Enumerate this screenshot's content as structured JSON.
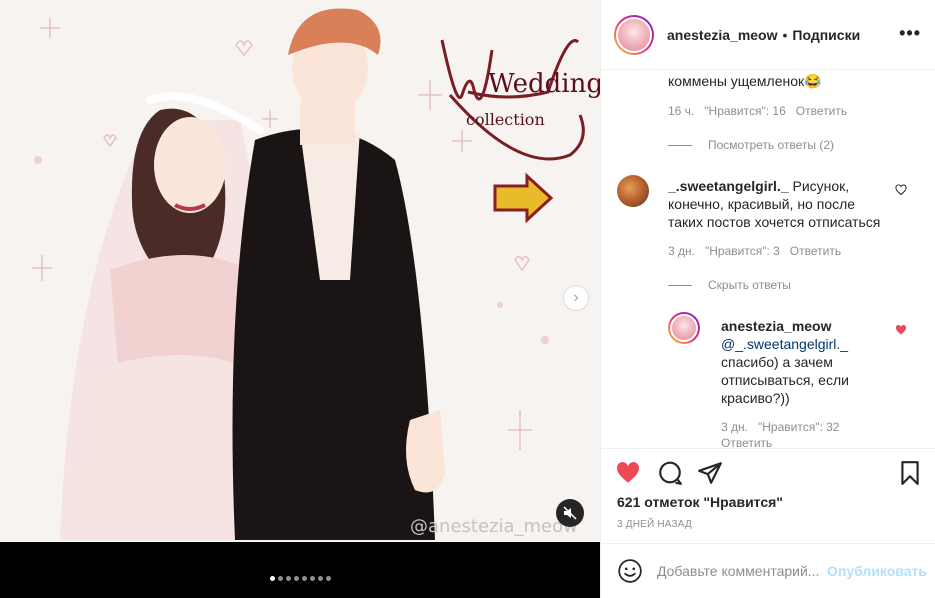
{
  "media": {
    "watermark": "@anestezia_meow",
    "title_main": "Wedding",
    "title_sub": "collection",
    "carousel_dots": 8,
    "active_dot": 0
  },
  "header": {
    "username": "anestezia_meow",
    "separator": "•",
    "follow_label": "Подписки",
    "more_label": "•••"
  },
  "comments": {
    "first_fragment": "коммены ущемленок😂",
    "first_meta": {
      "time": "16 ч.",
      "likes": "\"Нравится\": 16",
      "reply": "Ответить"
    },
    "view_replies": "Посмотреть ответы (2)",
    "second": {
      "username": "_.sweetangelgirl._",
      "text": "Рисунок, конечно, красивый, но после таких постов хочется отписаться",
      "meta": {
        "time": "3 дн.",
        "likes": "\"Нравится\": 3",
        "reply": "Ответить"
      }
    },
    "hide_replies": "Скрыть ответы",
    "reply": {
      "username": "anestezia_meow",
      "mention": "@_.sweetangelgirl._",
      "text": "спасибо) а зачем отписываться, если красиво?))",
      "meta": {
        "time": "3 дн.",
        "likes": "\"Нравится\": 32",
        "reply": "Ответить"
      }
    }
  },
  "actions": {
    "likes_text": "621 отметок \"Нравится\"",
    "time_text": "3 дней назад"
  },
  "add_comment": {
    "placeholder": "Добавьте комментарий...",
    "post_label": "Опубликовать"
  },
  "colors": {
    "like_red": "#ed4956",
    "link_blue": "#00376b",
    "post_disabled": "#b2dffc"
  }
}
